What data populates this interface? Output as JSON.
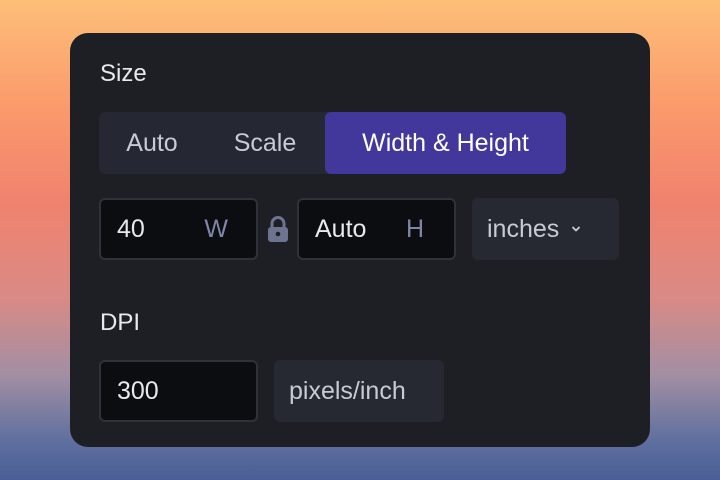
{
  "size": {
    "label": "Size",
    "modes": [
      {
        "label": "Auto",
        "selected": false
      },
      {
        "label": "Scale",
        "selected": false
      },
      {
        "label": "Width & Height",
        "selected": true
      }
    ],
    "width": {
      "value": "40",
      "suffix": "W"
    },
    "height": {
      "value": "Auto",
      "suffix": "H"
    },
    "lock_icon": "lock-icon",
    "unit": {
      "value": "inches",
      "icon": "chevron-down-icon"
    }
  },
  "dpi": {
    "label": "DPI",
    "value": "300",
    "unit": "pixels/inch"
  },
  "colors": {
    "panel": "#1e1f25",
    "accent": "#42379a",
    "input_bg": "#0c0d10",
    "muted_text": "#7f86a6"
  }
}
